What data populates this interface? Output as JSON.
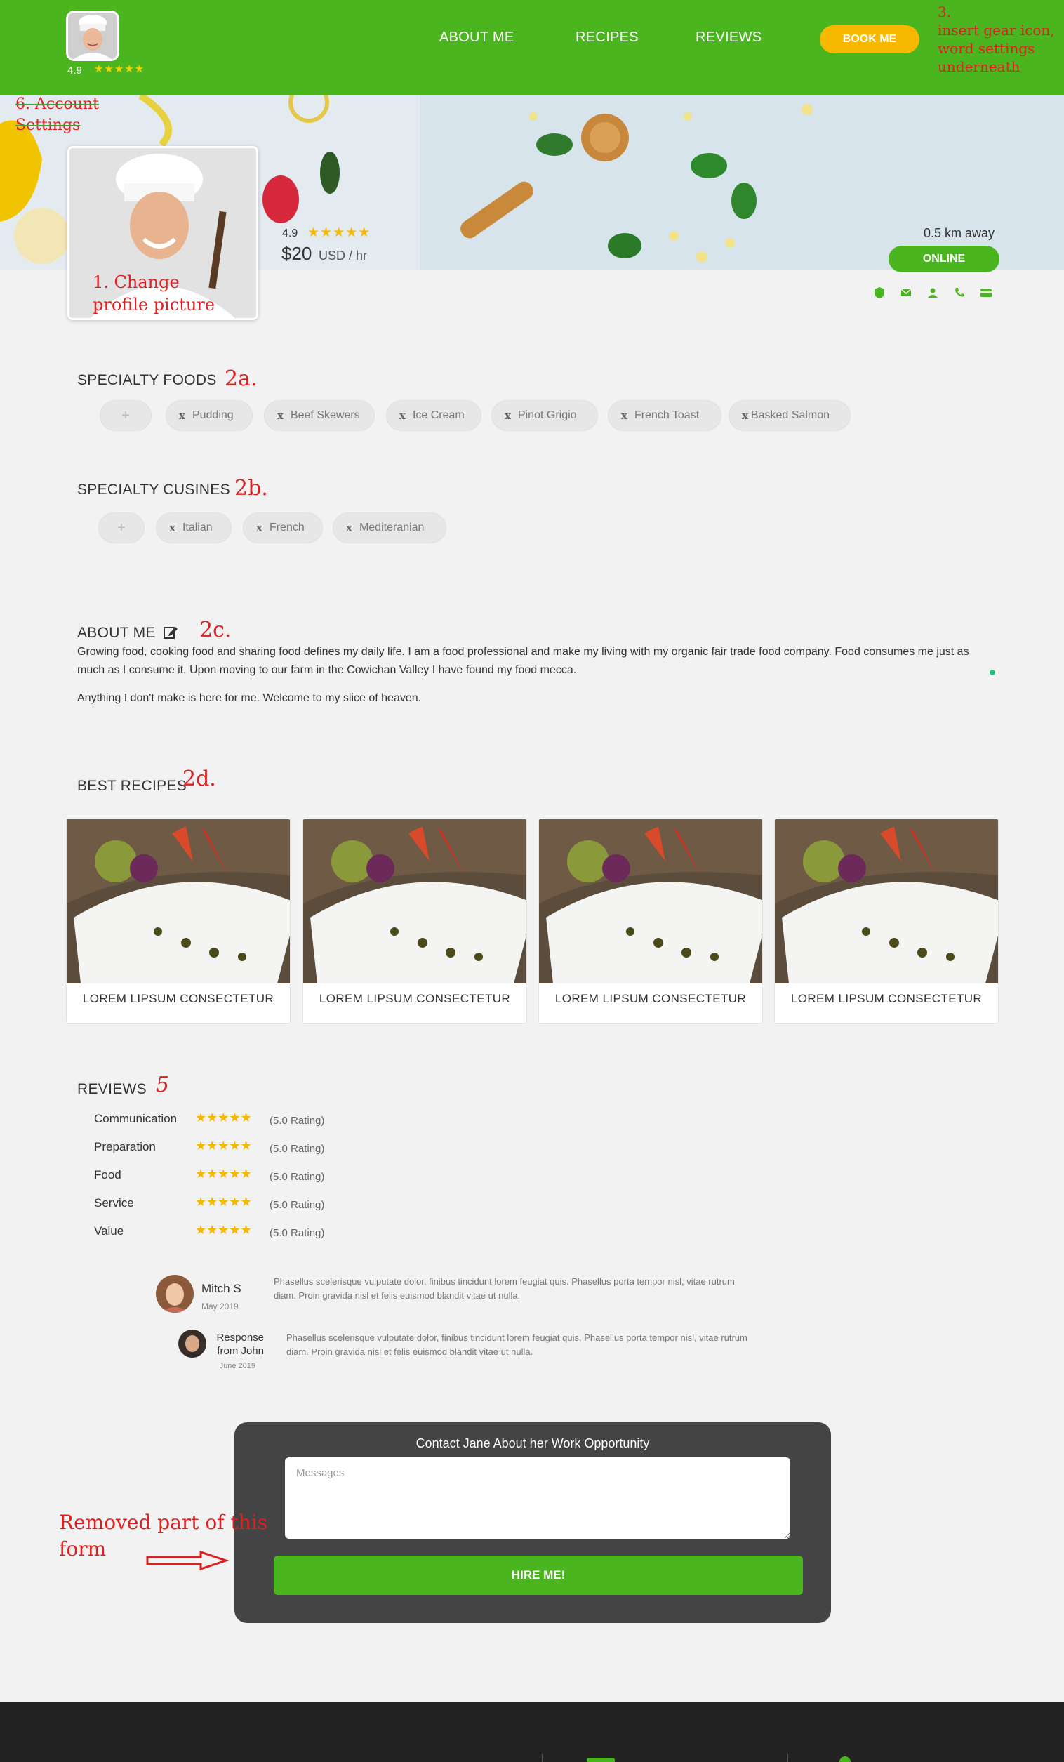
{
  "header": {
    "rating": "4.9",
    "stars": "★★★★★",
    "nav": [
      "ABOUT ME",
      "RECIPES",
      "REVIEWS"
    ],
    "book_label": "BOOK ME"
  },
  "annotations": {
    "a3": "3.\ninsert gear icon,\nword settings\nunderneath",
    "a6": "6. Account\nSettings",
    "a1": "1. Change\nprofile picture",
    "a2a": "2a.",
    "a2b": "2b.",
    "a2c": "2c.",
    "a2d": "2d.",
    "a5": "5",
    "removed": "Removed part of this\nform"
  },
  "profile": {
    "rating": "4.9",
    "stars": "★★★★★",
    "price": "$20",
    "price_unit": "USD / hr",
    "distance": "0.5 km away",
    "status": "ONLINE"
  },
  "specialty_foods": {
    "title": "SPECIALTY FOODS",
    "add": "+",
    "items": [
      "Pudding",
      "Beef Skewers",
      "Ice Cream",
      "Pinot Grigio",
      "French Toast",
      "Basked Salmon"
    ]
  },
  "specialty_cuisines": {
    "title": "SPECIALTY CUSINES",
    "add": "+",
    "items": [
      "Italian",
      "French",
      "Mediteranian"
    ]
  },
  "about": {
    "title": "ABOUT ME",
    "p1": "Growing food, cooking food and sharing food defines my daily life. I am a food professional and make my living with my organic fair trade food company. Food consumes me just as much as I consume it. Upon moving to our farm in the Cowichan Valley I have found my food mecca.",
    "p2": "Anything I don't make is here for me. Welcome to my slice of heaven."
  },
  "recipes": {
    "title": "BEST RECIPES",
    "items": [
      "LOREM LIPSUM CONSECTETUR",
      "LOREM LIPSUM CONSECTETUR",
      "LOREM LIPSUM CONSECTETUR",
      "LOREM LIPSUM CONSECTETUR"
    ]
  },
  "reviews": {
    "title": "REVIEWS",
    "categories": [
      {
        "label": "Communication",
        "rating": "(5.0 Rating)",
        "stars": "★★★★★"
      },
      {
        "label": "Preparation",
        "rating": "(5.0 Rating)",
        "stars": "★★★★★"
      },
      {
        "label": "Food",
        "rating": "(5.0 Rating)",
        "stars": "★★★★★"
      },
      {
        "label": "Service",
        "rating": "(5.0 Rating)",
        "stars": "★★★★★"
      },
      {
        "label": "Value",
        "rating": "(5.0 Rating)",
        "stars": "★★★★★"
      }
    ],
    "review": {
      "name": "Mitch S",
      "date": "May 2019",
      "text": "Phasellus scelerisque vulputate dolor, finibus tincidunt lorem feugiat quis. Phasellus porta tempor nisl, vitae rutrum diam. Proin gravida nisl et felis euismod blandit vitae ut nulla."
    },
    "response": {
      "name": "Response from John",
      "date": "June 2019",
      "text": "Phasellus scelerisque vulputate dolor, finibus tincidunt lorem feugiat quis. Phasellus porta tempor nisl, vitae rutrum diam. Proin gravida nisl et felis euismod blandit vitae ut nulla."
    }
  },
  "contact": {
    "title": "Contact Jane About her Work Opportunity",
    "placeholder": "Messages",
    "button": "HIRE ME!"
  },
  "colors": {
    "brand_green": "#4ab51f",
    "accent_yellow": "#f7b900",
    "annotation_red": "#e02020"
  }
}
